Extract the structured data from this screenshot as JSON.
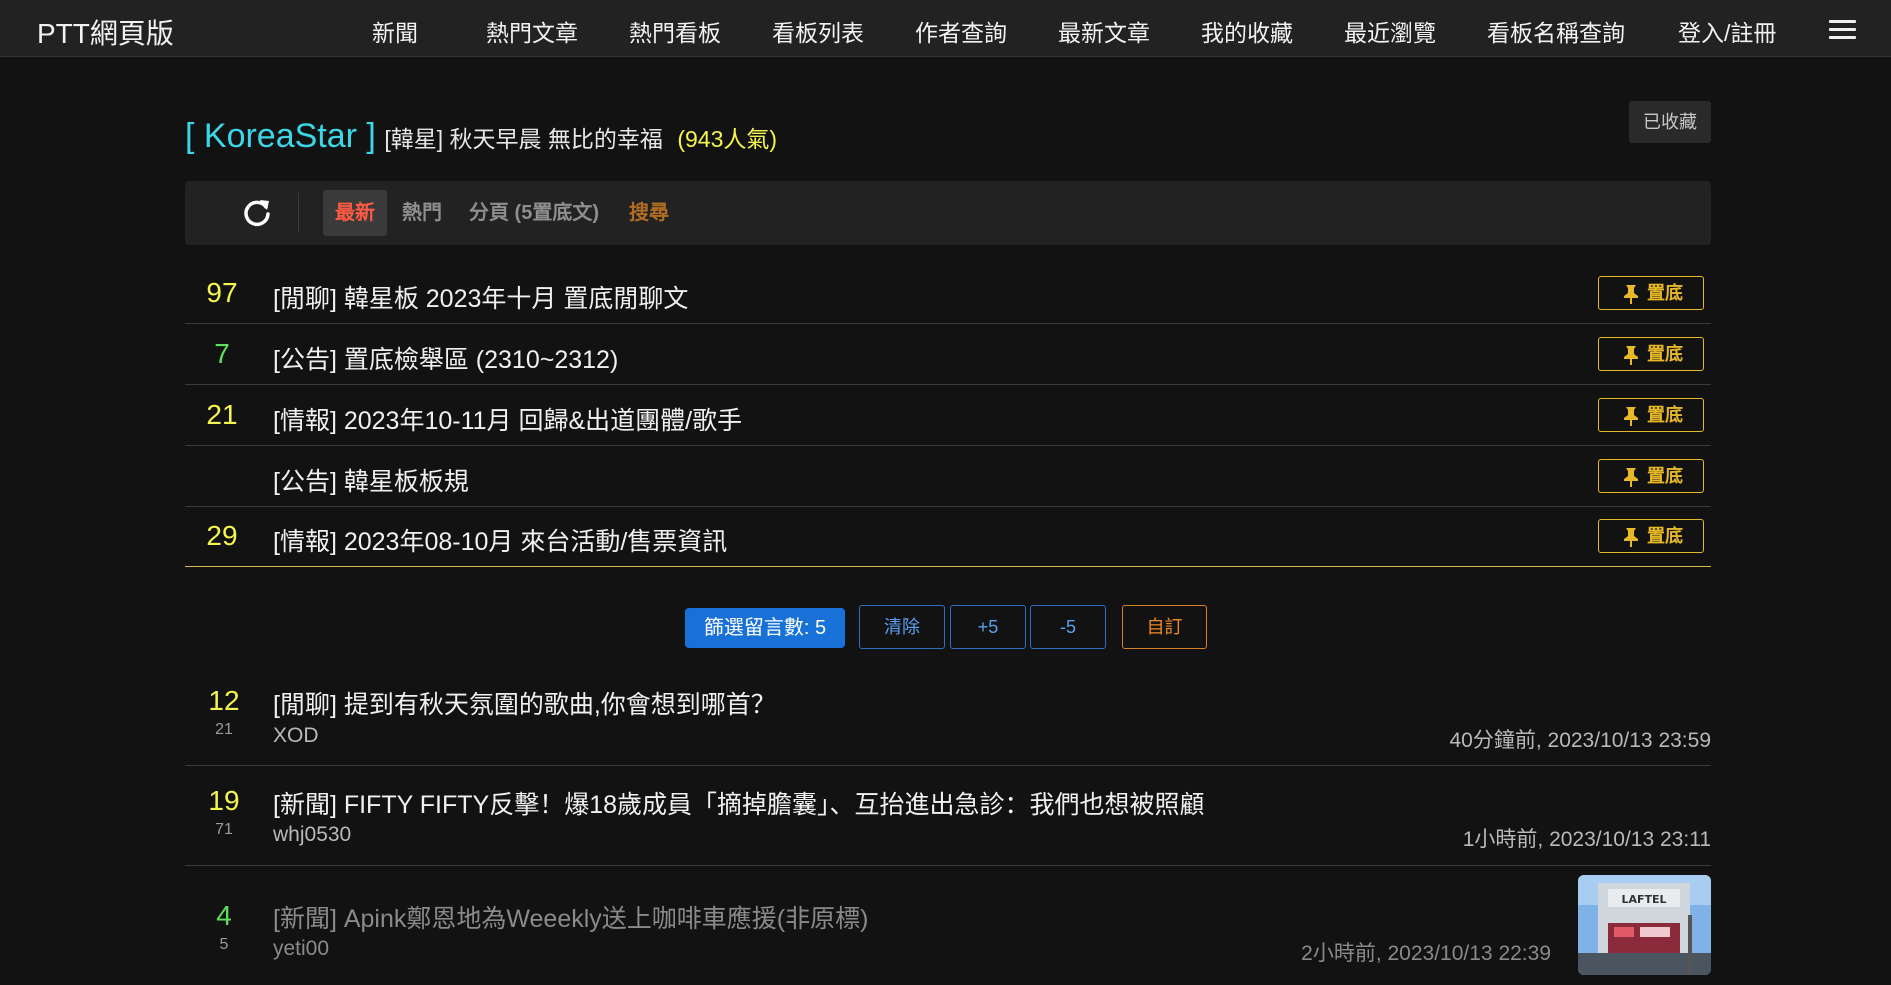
{
  "nav": {
    "brand": "PTT網頁版",
    "items": [
      "新聞",
      "熱門文章",
      "熱門看板",
      "看板列表",
      "作者查詢",
      "最新文章",
      "我的收藏",
      "最近瀏覽",
      "看板名稱查詢",
      "登入/註冊"
    ]
  },
  "board": {
    "name": "[ KoreaStar ]",
    "description": "[韓星] 秋天早晨 無比的幸福",
    "popularity": "(943人氣)",
    "favorite_label": "已收藏"
  },
  "toolbar": {
    "tab_latest": "最新",
    "tab_hot": "熱門",
    "tab_pages": "分頁 (5置底文)",
    "tab_search": "搜尋"
  },
  "sticky_posts": [
    {
      "count": "97",
      "title": "[閒聊] 韓星板 2023年十月 置底閒聊文",
      "badge": "置底"
    },
    {
      "count": "7",
      "title": "[公告] 置底檢舉區 (2310~2312)",
      "badge": "置底"
    },
    {
      "count": "21",
      "title": "[情報] 2023年10-11月 回歸&出道團體/歌手",
      "badge": "置底"
    },
    {
      "count": "",
      "title": "[公告] 韓星板板規",
      "badge": "置底"
    },
    {
      "count": "29",
      "title": "[情報] 2023年08-10月 來台活動/售票資訊",
      "badge": "置底"
    }
  ],
  "filter": {
    "label": "篩選留言數: 5",
    "clear": "清除",
    "plus": "+5",
    "minus": "-5",
    "custom": "自訂"
  },
  "posts": [
    {
      "count": "12",
      "sub": "21",
      "title": "[閒聊] 提到有秋天氛圍的歌曲,你會想到哪首？",
      "author": "XOD",
      "time": "40分鐘前, 2023/10/13 23:59"
    },
    {
      "count": "19",
      "sub": "71",
      "title": "[新聞] FIFTY FIFTY反擊！爆18歲成員「摘掉膽囊」、互抬進出急診：我們也想被照顧",
      "author": "whj0530",
      "time": "1小時前, 2023/10/13 23:11"
    },
    {
      "count": "4",
      "sub": "5",
      "title": "[新聞] Apink鄭恩地為Weeekly送上咖啡車應援(非原標)",
      "author": "yeti00",
      "time": "2小時前, 2023/10/13 22:39",
      "thumb_text": "LAFTEL"
    }
  ],
  "colors": {
    "count_yellow": "#f5f550",
    "count_green": "#5ee05e",
    "board_cyan": "#3cd6e6",
    "pin_gold": "#e7b928"
  }
}
